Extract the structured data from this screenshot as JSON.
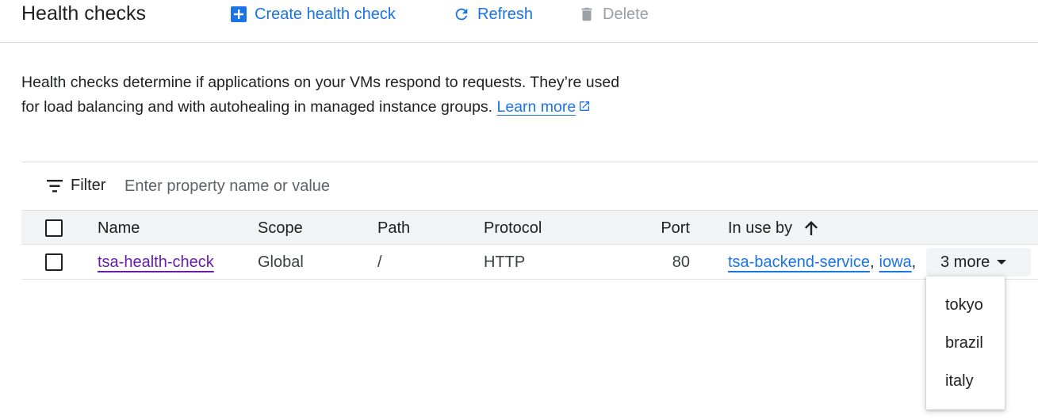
{
  "header": {
    "title": "Health checks",
    "create_label": "Create health check",
    "refresh_label": "Refresh",
    "delete_label": "Delete"
  },
  "description": {
    "text": "Health checks determine if applications on your VMs respond to requests. They’re used for load balancing and with autohealing in managed instance groups.",
    "link_label": "Learn more"
  },
  "filter": {
    "label": "Filter",
    "placeholder": "Enter property name or value"
  },
  "table": {
    "columns": {
      "name": "Name",
      "scope": "Scope",
      "path": "Path",
      "protocol": "Protocol",
      "port": "Port",
      "in_use_by": "In use by"
    },
    "sort": {
      "column": "In use by",
      "direction": "ascending"
    },
    "rows": [
      {
        "name": "tsa-health-check",
        "scope": "Global",
        "path": "/",
        "protocol": "HTTP",
        "port": "80",
        "in_use_by": [
          "tsa-backend-service",
          "iowa"
        ],
        "more_label": "3 more"
      }
    ]
  },
  "dropdown": {
    "items": [
      "tokyo",
      "brazil",
      "italy"
    ]
  },
  "colors": {
    "accent": "#1a73e8",
    "visited_link": "#681da8",
    "disabled": "#9aa0a6",
    "header_bg": "#f1f3f4",
    "divider": "#dadce0"
  },
  "icons": {
    "create": "add-box-icon",
    "refresh": "refresh-icon",
    "delete": "trash-icon",
    "filter": "filter-list-icon",
    "sort": "arrow-up-icon",
    "external": "external-link-icon",
    "caret": "caret-down-icon"
  }
}
